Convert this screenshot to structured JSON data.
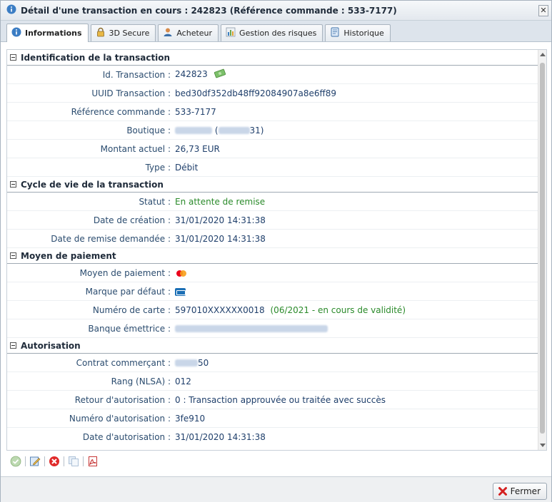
{
  "window": {
    "title": "Détail d'une transaction en cours : 242823 (Référence commande : 533-7177)",
    "close_label": "✕"
  },
  "tabs": [
    {
      "label": "Informations",
      "icon": "info-icon"
    },
    {
      "label": "3D Secure",
      "icon": "lock-icon"
    },
    {
      "label": "Acheteur",
      "icon": "user-icon"
    },
    {
      "label": "Gestion des risques",
      "icon": "chart-icon"
    },
    {
      "label": "Historique",
      "icon": "history-icon"
    }
  ],
  "sections": {
    "identification": {
      "title": "Identification de la transaction",
      "rows": [
        {
          "label": "Id. Transaction :",
          "value": "242823"
        },
        {
          "label": "UUID Transaction :",
          "value": "bed30df352db48ff92084907a8e6ff89"
        },
        {
          "label": "Référence commande :",
          "value": "533-7177"
        },
        {
          "label": "Boutique :",
          "value_suffix": "31)"
        },
        {
          "label": "Montant actuel :",
          "value": "26,73 EUR"
        },
        {
          "label": "Type :",
          "value": "Débit"
        }
      ]
    },
    "cycle": {
      "title": "Cycle de vie de la transaction",
      "rows": [
        {
          "label": "Statut :",
          "value": "En attente de remise"
        },
        {
          "label": "Date de création :",
          "value": "31/01/2020 14:31:38"
        },
        {
          "label": "Date de remise demandée :",
          "value": "31/01/2020 14:31:38"
        }
      ]
    },
    "paiement": {
      "title": "Moyen de paiement",
      "rows": [
        {
          "label": "Moyen de paiement :",
          "icon": "mastercard-icon"
        },
        {
          "label": "Marque par défaut :",
          "icon": "cb-card-icon"
        },
        {
          "label": "Numéro de carte :",
          "value": "597010XXXXXX0018",
          "value_extra": "(06/2021 - en cours de validité)"
        },
        {
          "label": "Banque émettrice :"
        }
      ]
    },
    "autorisation": {
      "title": "Autorisation",
      "rows": [
        {
          "label": "Contrat commerçant :",
          "value_suffix": "50"
        },
        {
          "label": "Rang (NLSA) :",
          "value": "012"
        },
        {
          "label": "Retour d'autorisation :",
          "value": "0 : Transaction approuvée ou traitée avec succès"
        },
        {
          "label": "Numéro d'autorisation :",
          "value": "3fe910"
        },
        {
          "label": "Date d'autorisation :",
          "value": "31/01/2020 14:31:38"
        }
      ]
    }
  },
  "footer": {
    "close_button": "Fermer"
  },
  "colors": {
    "label": "#2b4c6f",
    "value": "#1f3f6b",
    "status_green": "#2a8a2a"
  }
}
